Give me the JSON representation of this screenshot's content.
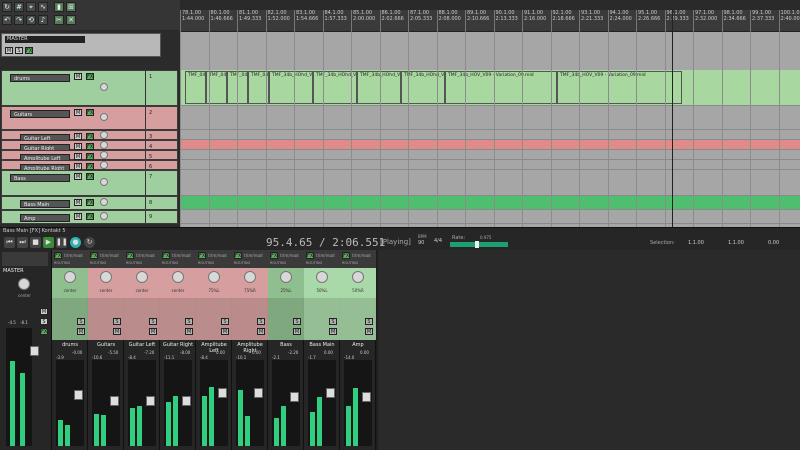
{
  "ruler": {
    "marks": [
      {
        "bar": "78.1.00",
        "time": "1:44.000"
      },
      {
        "bar": "80.1.00",
        "time": "1:46.666"
      },
      {
        "bar": "81.1.00",
        "time": "1:49.333"
      },
      {
        "bar": "82.1.00",
        "time": "1:52.000"
      },
      {
        "bar": "83.1.00",
        "time": "1:54.666"
      },
      {
        "bar": "84.1.00",
        "time": "1:57.333"
      },
      {
        "bar": "85.1.00",
        "time": "2:00.000"
      },
      {
        "bar": "86.1.00",
        "time": "2:02.666"
      },
      {
        "bar": "87.1.00",
        "time": "2:05.333"
      },
      {
        "bar": "88.1.00",
        "time": "2:08.000"
      },
      {
        "bar": "89.1.00",
        "time": "2:10.666"
      },
      {
        "bar": "90.1.00",
        "time": "2:13.333"
      },
      {
        "bar": "91.1.00",
        "time": "2:16.000"
      },
      {
        "bar": "92.1.00",
        "time": "2:18.666"
      },
      {
        "bar": "93.1.00",
        "time": "2:21.333"
      },
      {
        "bar": "94.1.00",
        "time": "2:24.000"
      },
      {
        "bar": "95.1.00",
        "time": "2:26.666"
      },
      {
        "bar": "96.1.00",
        "time": "2:29.333"
      },
      {
        "bar": "97.1.00",
        "time": "2:32.000"
      },
      {
        "bar": "98.1.00",
        "time": "2:34.666"
      },
      {
        "bar": "99.1.00",
        "time": "2:37.333"
      },
      {
        "bar": "100.1.00",
        "time": "2:40.000"
      }
    ]
  },
  "tcp": {
    "master_label": "MASTER",
    "tracks": [
      {
        "name": "drums",
        "num": "1",
        "type": "folder",
        "color": "#9fcf9f"
      },
      {
        "name": "Guitars",
        "num": "2",
        "type": "folder",
        "color": "#d69e9e"
      },
      {
        "name": "Guitar Left",
        "num": "3",
        "type": "child",
        "color": "#d69e9e"
      },
      {
        "name": "Guitar Right",
        "num": "4",
        "type": "child",
        "color": "#d69e9e"
      },
      {
        "name": "Amplitube Left",
        "num": "5",
        "type": "child",
        "color": "#d69e9e"
      },
      {
        "name": "Amplitube Right",
        "num": "6",
        "type": "child",
        "color": "#d69e9e"
      },
      {
        "name": "Bass",
        "num": "7",
        "type": "folder",
        "color": "#9fcf9f"
      },
      {
        "name": "Bass Main",
        "num": "8",
        "type": "child",
        "color": "#9fcf9f"
      },
      {
        "name": "Amp",
        "num": "9",
        "type": "child",
        "color": "#9fcf9f"
      }
    ]
  },
  "items": {
    "drums": [
      "TMF_04...",
      "TMF_04...",
      "TMF_04...",
      "TMF_04...",
      "TMF_34b_HOhd_V04 - V...",
      "TMF_34b_HOhd_V04 - V...",
      "TMF_34b_HOhd_V04 - V...",
      "TMF_34b_HOhd_V04 - V...",
      "TMF_34b_HOV_V09 - Variation_09.mid",
      "TMF_34b_HOV_V09 - Variation_09.mid"
    ]
  },
  "transport": {
    "status_line": "Bass Main [FX] Kontakt 5",
    "position": "95.4.65 / 2:06.551",
    "state": "[Playing]",
    "bpm_label": "BPM",
    "bpm_value": "90",
    "time_sig": "4/4",
    "rate_label": "Rate:",
    "rate_value": "0.975",
    "selection_label": "Selection:",
    "sel_start": "1.1.00",
    "sel_end": "1.1.00",
    "sel_len": "0.00"
  },
  "mixer": {
    "master": {
      "label": "MASTER",
      "pan": "center",
      "db_left": "-4.5",
      "db_right": "-8.1"
    },
    "strips": [
      {
        "label": "drums",
        "pan": "center",
        "vol": "-0.00",
        "peak": "-3.9",
        "color": "#8fbf8f"
      },
      {
        "label": "Guitars",
        "pan": "center",
        "vol": "-5.50",
        "peak": "-10.6",
        "color": "#d69e9e"
      },
      {
        "label": "Guitar Left",
        "pan": "center",
        "vol": "-7.20",
        "peak": "-8.4",
        "color": "#d69e9e"
      },
      {
        "label": "Guitar Right",
        "pan": "center",
        "vol": "-8.00",
        "peak": "-11.1",
        "color": "#d69e9e"
      },
      {
        "label": "Amplitube Left",
        "pan": "75%L",
        "vol": "0.00",
        "peak": "-8.4",
        "color": "#d69e9e"
      },
      {
        "label": "Amplitube Right",
        "pan": "75%R",
        "vol": "0.00",
        "peak": "-10.1",
        "color": "#d69e9e"
      },
      {
        "label": "Bass",
        "pan": "25%L",
        "vol": "-2.20",
        "peak": "-2.1",
        "color": "#8fbf8f"
      },
      {
        "label": "Bass Main",
        "pan": "50%L",
        "vol": "0.00",
        "peak": "-1.7",
        "color": "#a9d9a9"
      },
      {
        "label": "Amp",
        "pan": "50%R",
        "vol": "0.00",
        "peak": "-14.0",
        "color": "#a9d9a9"
      }
    ],
    "strip_buttons": {
      "route": "ROUTING",
      "mute": "M",
      "solo": "S",
      "fx": "FX",
      "trim": "trim/read"
    }
  },
  "colors": {
    "accent_green": "#2fcf7f",
    "red_track": "#d69e9e",
    "green_track": "#9fcf9f"
  }
}
